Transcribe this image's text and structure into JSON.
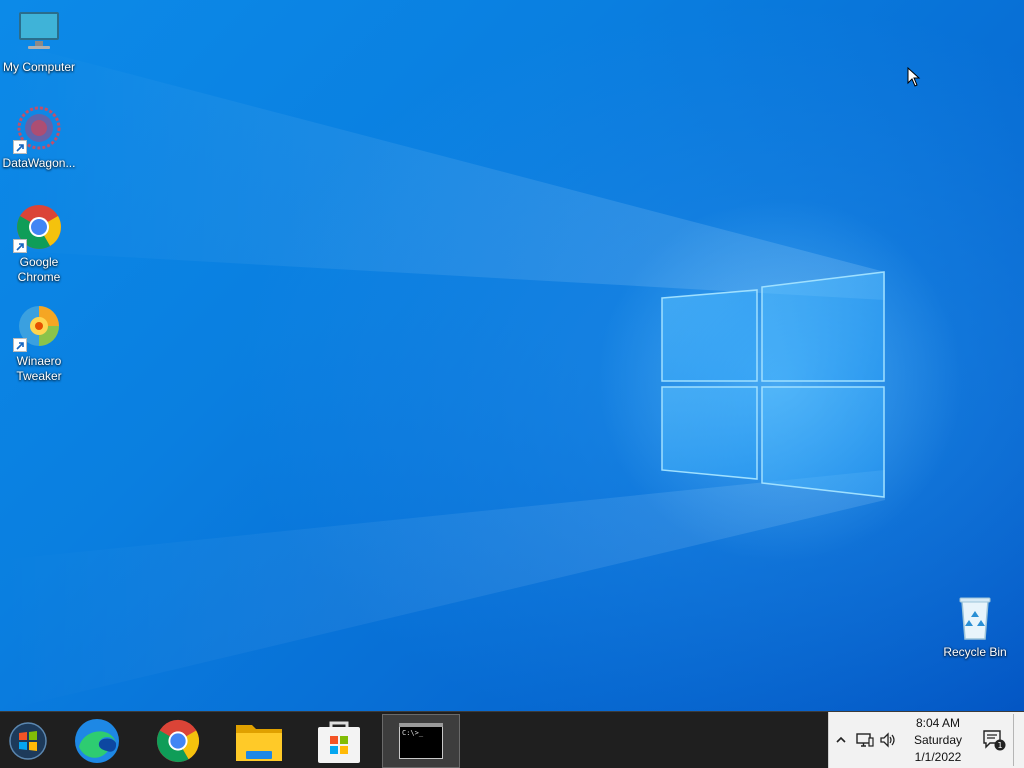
{
  "desktop": {
    "icons": [
      {
        "label": "My Computer",
        "icon": "monitor-icon",
        "shortcut": false
      },
      {
        "label": "DataWagon...",
        "icon": "datawagon-icon",
        "shortcut": true
      },
      {
        "label": "Google Chrome",
        "icon": "chrome-icon",
        "shortcut": true
      },
      {
        "label": "Winaero Tweaker",
        "icon": "winaero-tweaker-icon",
        "shortcut": true
      },
      {
        "label": "Recycle Bin",
        "icon": "recycle-bin-icon",
        "shortcut": false
      }
    ]
  },
  "taskbar": {
    "start": {
      "icon": "windows-orb-icon"
    },
    "pinned": [
      {
        "app": "edge",
        "icon": "edge-icon"
      },
      {
        "app": "chrome",
        "icon": "chrome-icon"
      },
      {
        "app": "file-explorer",
        "icon": "folder-icon"
      },
      {
        "app": "store",
        "icon": "store-icon"
      },
      {
        "app": "command-prompt",
        "icon": "cmd-icon",
        "active": true,
        "glyph_text": "C:\\>_"
      }
    ],
    "tray": {
      "icons": [
        "chevron-up-icon",
        "network-icon",
        "speaker-icon",
        "notification-icon"
      ],
      "notification_count": "1",
      "clock": {
        "time": "8:04 AM",
        "day": "Saturday",
        "date": "1/1/2022"
      }
    }
  },
  "colors": {
    "wallpaper": "#0a78d7",
    "taskbar": "#1f1f1f",
    "tray": "#f2f2f2"
  }
}
